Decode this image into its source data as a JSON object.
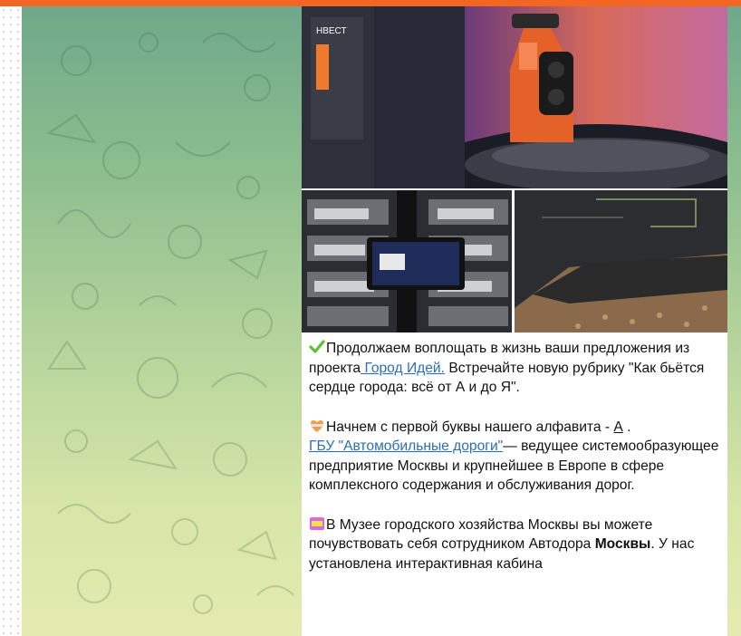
{
  "message": {
    "photos": [
      {
        "name": "photo-museum-hall",
        "sign_text": "НВЕСТ"
      },
      {
        "name": "photo-vehicle-models"
      },
      {
        "name": "photo-road-layers"
      }
    ],
    "paragraph1": {
      "text_before": "Продолжаем воплощать в жизнь ваши предложения из проекта",
      "link": " Город Идей.",
      "text_after": " Встречайте новую рубрику \"Как бьётся сердце города: всё от А и до Я\"."
    },
    "paragraph2": {
      "text_before": "Начнем с первой буквы нашего алфавита - ",
      "letter_link": "А",
      "text_mid": " .",
      "org_link": "ГБУ \"Автомобильные дороги\"",
      "text_after": "— ведущее системообразующее предприятие Москвы и крупнейшее в Европе в сфере комплексного содержания и обслуживания дорог."
    },
    "paragraph3": {
      "text_before": "В Музее городского хозяйства Москвы вы можете почувствовать себя сотрудником Автодора ",
      "bold": "Москвы",
      "text_after": ". У нас установлена интерактивная кабина"
    }
  },
  "colors": {
    "accent_bar": "#f26522",
    "link": "#2a6fb5",
    "check_emoji": "#5bc236",
    "heart_emoji": "#f0a040",
    "az_emoji": "#d66be0"
  },
  "icons": [
    "check-mark-icon",
    "heart-icon",
    "letters-emoji-icon"
  ]
}
